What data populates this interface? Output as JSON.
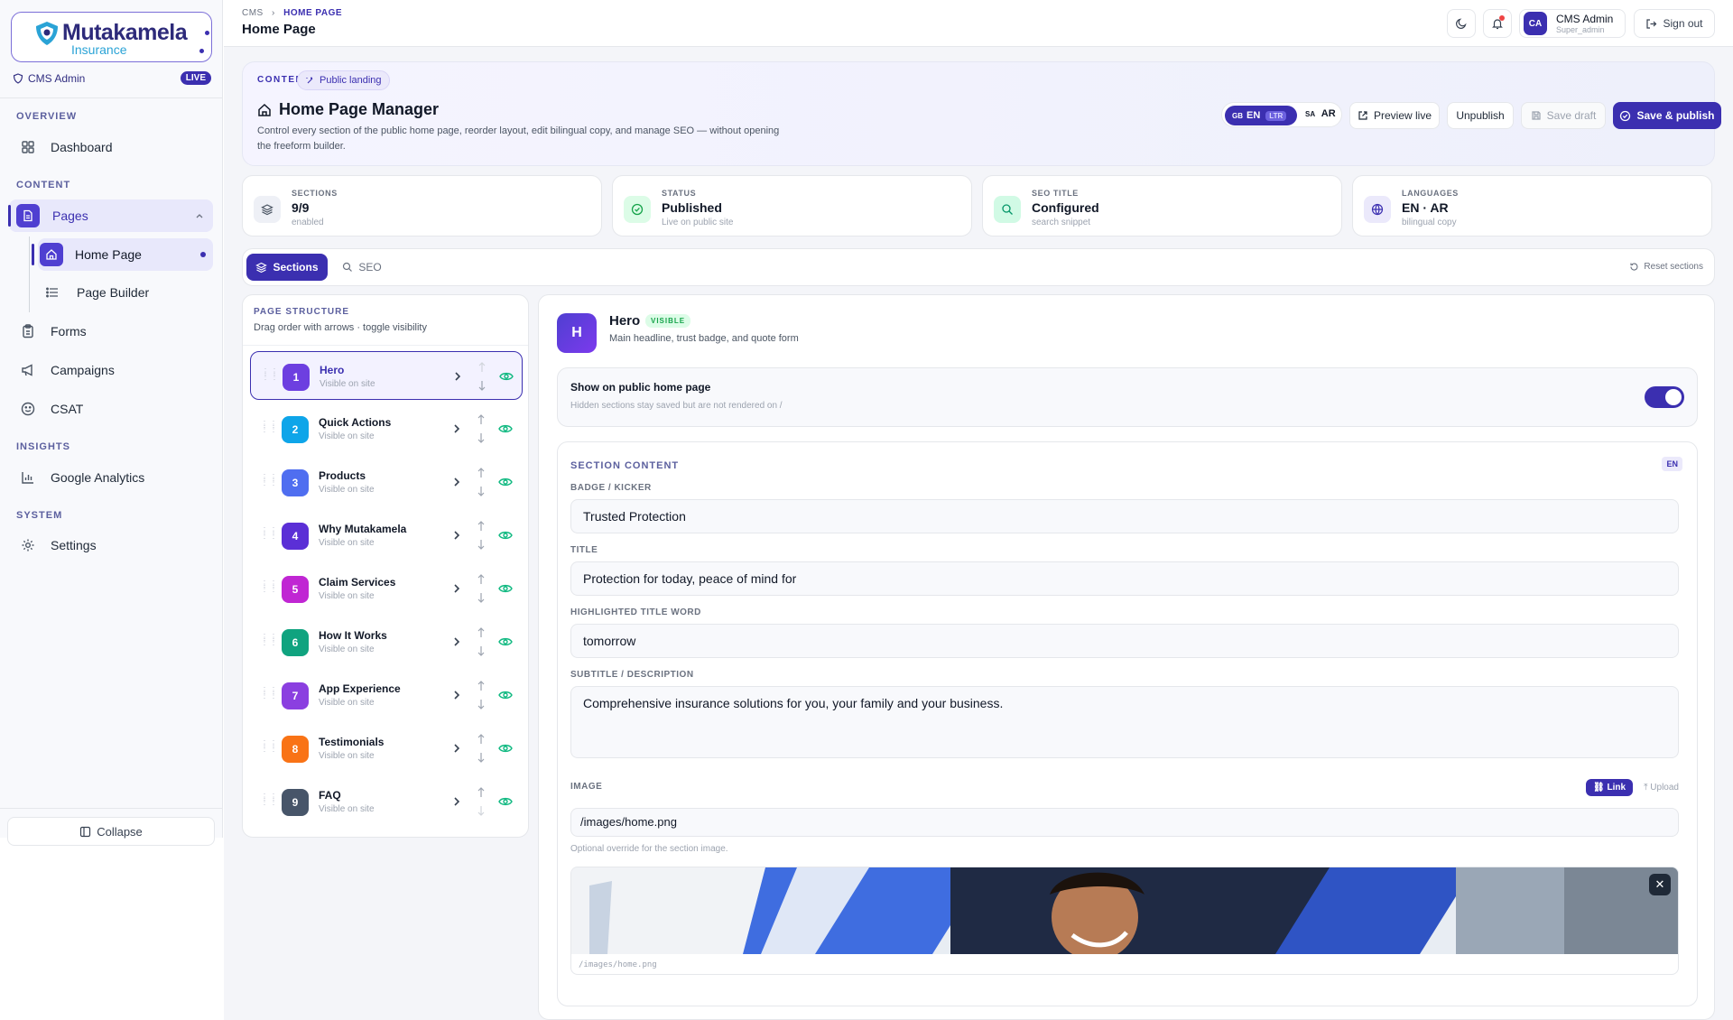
{
  "brand": {
    "name": "Mutakamela",
    "sub": "Insurance"
  },
  "sidebar": {
    "admin_label": "CMS Admin",
    "live_badge": "LIVE",
    "sections": {
      "overview": "OVERVIEW",
      "content": "CONTENT",
      "insights": "INSIGHTS",
      "system": "SYSTEM"
    },
    "items": {
      "dashboard": "Dashboard",
      "pages": "Pages",
      "home_page": "Home Page",
      "page_builder": "Page Builder",
      "forms": "Forms",
      "campaigns": "Campaigns",
      "csat": "CSAT",
      "google_analytics": "Google Analytics",
      "settings": "Settings"
    },
    "collapse": "Collapse"
  },
  "topbar": {
    "crumb_root": "CMS",
    "crumb_current": "HOME PAGE",
    "title": "Home Page",
    "user_initials": "CA",
    "user_name": "CMS Admin",
    "user_role": "Super_admin",
    "sign_out": "Sign out"
  },
  "header": {
    "kicker": "CONTENT",
    "pill": "Public landing",
    "title": "Home Page Manager",
    "description": "Control every section of the public home page, reorder layout, edit bilingual copy, and manage SEO — without opening the freeform builder.",
    "lang_en_flag": "GB",
    "lang_en": "EN",
    "lang_ltr": "LTR",
    "lang_ar_flag": "SA",
    "lang_ar": "AR",
    "preview_live": "Preview live",
    "unpublish": "Unpublish",
    "save_draft": "Save draft",
    "save_publish": "Save & publish"
  },
  "stats": [
    {
      "label": "SECTIONS",
      "value": "9/9",
      "sub": "enabled"
    },
    {
      "label": "STATUS",
      "value": "Published",
      "sub": "Live on public site"
    },
    {
      "label": "SEO TITLE",
      "value": "Configured",
      "sub": "search snippet"
    },
    {
      "label": "LANGUAGES",
      "value": "EN · AR",
      "sub": "bilingual copy"
    }
  ],
  "tabs": {
    "sections": "Sections",
    "seo": "SEO",
    "reset": "Reset sections"
  },
  "structure": {
    "title": "PAGE STRUCTURE",
    "subtitle": "Drag order with arrows · toggle visibility",
    "visible_text": "Visible on site",
    "rows": [
      {
        "num": "1",
        "name": "Hero",
        "color": "#6d3fe0"
      },
      {
        "num": "2",
        "name": "Quick Actions",
        "color": "#0ea5e9"
      },
      {
        "num": "3",
        "name": "Products",
        "color": "#4f6ef0"
      },
      {
        "num": "4",
        "name": "Why Mutakamela",
        "color": "#5b2fd6"
      },
      {
        "num": "5",
        "name": "Claim Services",
        "color": "#c026d3"
      },
      {
        "num": "6",
        "name": "How It Works",
        "color": "#10a37f"
      },
      {
        "num": "7",
        "name": "App Experience",
        "color": "#8b3fe0"
      },
      {
        "num": "8",
        "name": "Testimonials",
        "color": "#f97316"
      },
      {
        "num": "9",
        "name": "FAQ",
        "color": "#475569"
      }
    ]
  },
  "detail": {
    "initial": "H",
    "title": "Hero",
    "visible_badge": "VISIBLE",
    "subtitle": "Main headline, trust badge, and quote form",
    "toggle_title": "Show on public home page",
    "toggle_sub": "Hidden sections stay saved but are not rendered on /",
    "toggle_on": true,
    "content_title": "SECTION CONTENT",
    "lang_badge": "EN",
    "fields": {
      "badge_label": "BADGE / KICKER",
      "badge_value": "Trusted Protection",
      "title_label": "TITLE",
      "title_value": "Protection for today, peace of mind for",
      "highlight_label": "HIGHLIGHTED TITLE WORD",
      "highlight_value": "tomorrow",
      "subtitle_label": "SUBTITLE / DESCRIPTION",
      "subtitle_value": "Comprehensive insurance solutions for you, your family and your business.",
      "image_label": "IMAGE",
      "image_value": "/images/home.png",
      "image_hint": "Optional override for the section image.",
      "image_caption": "/images/home.png",
      "link_btn": "Link",
      "upload_btn": "Upload"
    }
  },
  "colors": {
    "accent": "#3b2fb0",
    "success": "#10b981"
  }
}
